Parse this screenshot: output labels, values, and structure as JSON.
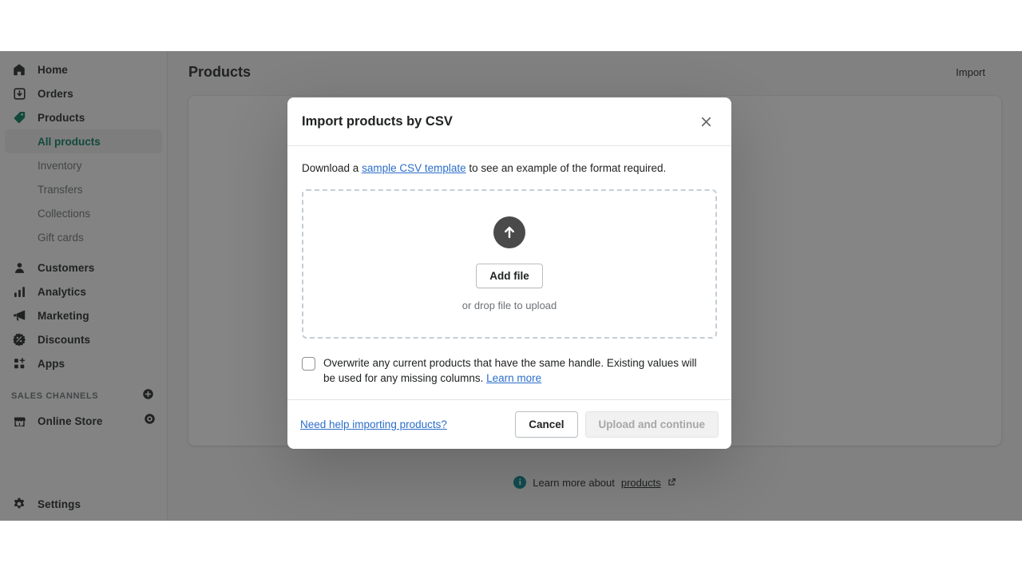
{
  "sidebar": {
    "items": [
      {
        "label": "Home",
        "icon": "home-icon",
        "type": "top"
      },
      {
        "label": "Orders",
        "icon": "orders-icon",
        "type": "top"
      },
      {
        "label": "Products",
        "icon": "products-tag-icon",
        "type": "top"
      },
      {
        "label": "All products",
        "type": "sub",
        "active": true
      },
      {
        "label": "Inventory",
        "type": "sub",
        "active": false
      },
      {
        "label": "Transfers",
        "type": "sub",
        "active": false
      },
      {
        "label": "Collections",
        "type": "sub",
        "active": false
      },
      {
        "label": "Gift cards",
        "type": "sub",
        "active": false
      },
      {
        "label": "Customers",
        "icon": "customers-icon",
        "type": "top"
      },
      {
        "label": "Analytics",
        "icon": "analytics-icon",
        "type": "top"
      },
      {
        "label": "Marketing",
        "icon": "marketing-megaphone-icon",
        "type": "top"
      },
      {
        "label": "Discounts",
        "icon": "discounts-icon",
        "type": "top"
      },
      {
        "label": "Apps",
        "icon": "apps-icon",
        "type": "top"
      }
    ],
    "sales_channels": {
      "heading": "SALES CHANNELS",
      "add_icon": "plus-circle-icon",
      "items": [
        {
          "label": "Online Store",
          "icon": "store-icon",
          "action_icon": "eye-icon"
        }
      ]
    },
    "settings": {
      "label": "Settings",
      "icon": "gear-icon"
    }
  },
  "page": {
    "title": "Products",
    "import_action": "Import",
    "footer": {
      "prefix": "Learn more about",
      "link": "products",
      "external_icon": "external-link-icon",
      "info_icon": "info-icon",
      "info_glyph": "i"
    }
  },
  "modal": {
    "title": "Import products by CSV",
    "close_icon": "close-icon",
    "intro": {
      "before": "Download a ",
      "link": "sample CSV template",
      "after": " to see an example of the format required."
    },
    "dropzone": {
      "upload_icon": "upload-arrow-icon",
      "add_file_label": "Add file",
      "drop_hint": "or drop file to upload"
    },
    "overwrite": {
      "checked": false,
      "text": "Overwrite any current products that have the same handle. Existing values will be used for any missing columns. ",
      "learn_more": "Learn more"
    },
    "footer": {
      "help_link": "Need help importing products?",
      "cancel_label": "Cancel",
      "submit_label": "Upload and continue",
      "submit_disabled": true
    }
  },
  "colors": {
    "accent_green": "#007b5c",
    "link_blue": "#2c6ecb",
    "info_teal": "#00848e",
    "upload_circle": "#4a4a4a"
  }
}
